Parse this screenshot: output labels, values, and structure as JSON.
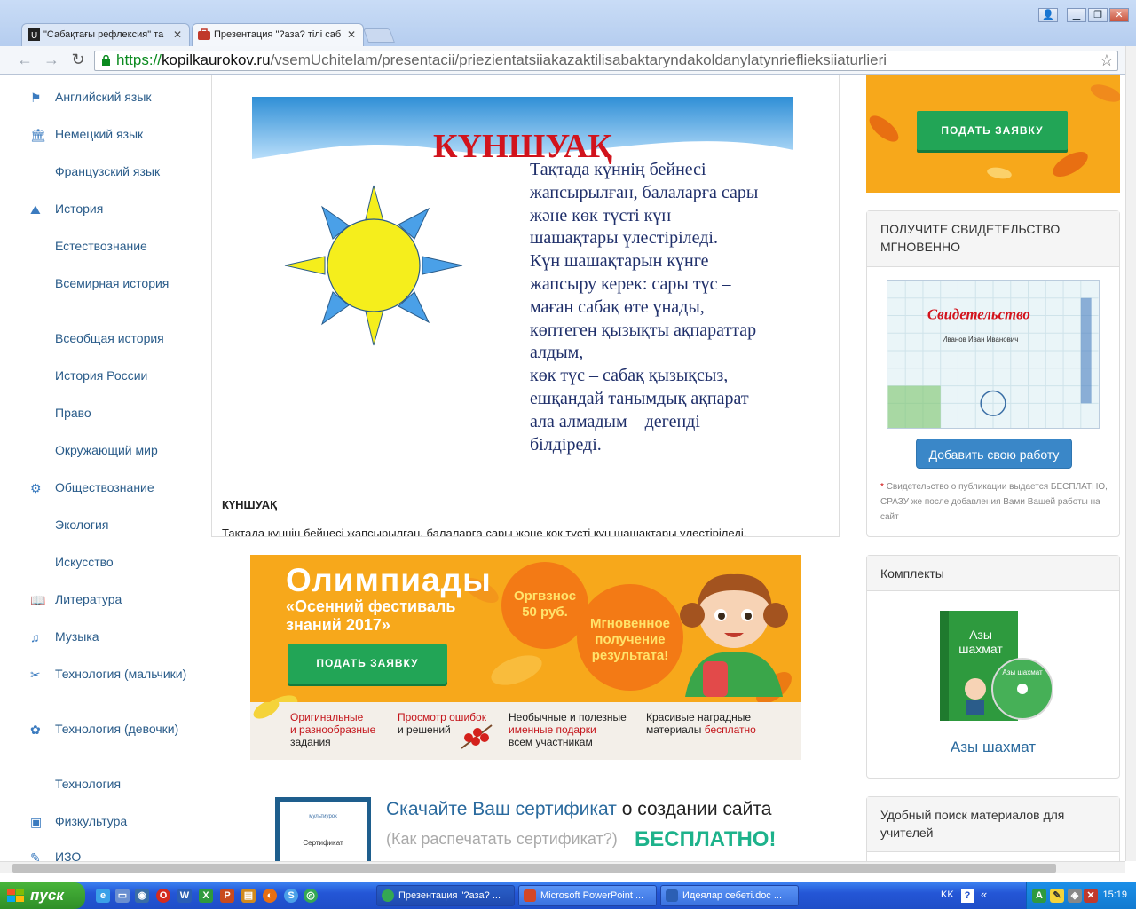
{
  "browser": {
    "tabs": [
      {
        "title": "\"Сабақтағы рефлексия\" та",
        "icon": "ustatv-favicon"
      },
      {
        "title": "Презентация \"?аза? тілі саб",
        "icon": "kopilkaurokov-favicon"
      }
    ],
    "window_buttons": [
      "user-icon",
      "minimize-icon",
      "restore-icon",
      "close-icon"
    ],
    "url": {
      "scheme": "https://",
      "host": "kopilkaurokov.ru",
      "path": "/vsemUchitelam/presentacii/priezientatsiiakazaktilisabaktaryndakoldanylatynrieflieksiiaturlieri"
    }
  },
  "sidebar": {
    "items": [
      {
        "label": "Английский язык",
        "icon": "english-icon"
      },
      {
        "label": "Немецкий язык",
        "icon": "german-icon"
      },
      {
        "label": "Французский язык",
        "icon": ""
      },
      {
        "label": "История",
        "icon": "history-icon"
      },
      {
        "label": "Естествознание",
        "icon": ""
      },
      {
        "label": "Всемирная история",
        "icon": ""
      },
      {
        "label": "Всеобщая история",
        "icon": ""
      },
      {
        "label": "История России",
        "icon": ""
      },
      {
        "label": "Право",
        "icon": ""
      },
      {
        "label": "Окружающий мир",
        "icon": ""
      },
      {
        "label": "Обществознание",
        "icon": "society-icon"
      },
      {
        "label": "Экология",
        "icon": ""
      },
      {
        "label": "Искусство",
        "icon": ""
      },
      {
        "label": "Литература",
        "icon": "book-icon"
      },
      {
        "label": "Музыка",
        "icon": "music-icon"
      },
      {
        "label": "Технология (мальчики)",
        "icon": "tools-icon"
      },
      {
        "label": "Технология (девочки)",
        "icon": "sewing-icon"
      },
      {
        "label": "Технология",
        "icon": ""
      },
      {
        "label": "Физкультура",
        "icon": "sport-icon"
      },
      {
        "label": "ИЗО",
        "icon": "art-icon"
      }
    ]
  },
  "slide": {
    "title": "КҮНШУАҚ",
    "text": "Тақтада күннің бейнесі\nжапсырылған, балаларға сары\nжәне көк түсті күн\nшашақтары  үлестіріледі.\nКүн шашақтарын күнге\nжапсыру керек: сары түс –\nмаған сабақ өте ұнады,\nкөптеген қызықты ақпараттар\nалдым,\n көк түс – сабақ қызықсыз,\nешқандай танымдық ақпарат\nала алмадым – дегенді\nбілдіреді."
  },
  "content": {
    "heading": "КҮНШУАҚ",
    "description": "Тақтада күннің бейнесі жапсырылған, балаларға сары және көк түсті күн шашақтары  үлестіріледі."
  },
  "olympiad_banner": {
    "title": "Олимпиады",
    "subtitle": "«Осенний фестиваль\nзнаний 2017»",
    "button": "ПОДАТЬ ЗАЯВКУ",
    "fee": "Оргвзнос\n50 руб.",
    "instant": "Мгновенное\nполучение\nрезультата!",
    "features": [
      {
        "line1_red": "Оригинальные",
        "line2_red": "и разнообразные",
        "line3": "задания"
      },
      {
        "line1_red": "Просмотр ошибок",
        "line2": "и решений"
      },
      {
        "line1": "Необычные и полезные",
        "line2_red": "именные подарки",
        "line3": "всем участникам"
      },
      {
        "line1": "Красивые наградные",
        "line2": "материалы",
        "line2_red_tail": "бесплатно"
      }
    ]
  },
  "cert_banner": {
    "title_blue": "Скачайте Ваш сертификат",
    "title_dark": "о создании сайта",
    "howto": "(Как распечатать сертификат?)",
    "free": "БЕСПЛАТНО!",
    "thumb_brand": "мультиурок",
    "thumb_label": "Сертификат"
  },
  "right_column": {
    "top_ad_button": "ПОДАТЬ ЗАЯВКУ",
    "certificate_panel": {
      "heading": "ПОЛУЧИТЕ СВИДЕТЕЛЬСТВО МГНОВЕННО",
      "cert_word": "Свидетельство",
      "cert_name": "Иванов Иван Иванович",
      "button": "Добавить свою работу",
      "note_star": "*",
      "note": "Свидетельство о публикации выдается БЕСПЛАТНО, СРАЗУ же после добавления Вами Вашей работы на сайт"
    },
    "kits_panel": {
      "heading": "Комплекты",
      "box_title": "Азы шахмат",
      "disc_label": "Азы шахмат",
      "item": "Азы шахмат"
    },
    "search_panel": {
      "heading": "Удобный поиск материалов для учителей"
    }
  },
  "taskbar": {
    "start": "пуск",
    "tasks": [
      {
        "title": "Презентация \"?аза? ...",
        "icon": "chrome-icon"
      },
      {
        "title": "Microsoft PowerPoint ...",
        "icon": "powerpoint-icon"
      },
      {
        "title": "Идеялар себеті.doc ...",
        "icon": "word-icon"
      }
    ],
    "lang": "KK",
    "clock": "15:19"
  },
  "colors": {
    "accent_orange": "#f7a81b",
    "green_button": "#22a556",
    "blue_button": "#3a87c8",
    "link_blue": "#2a5c8a",
    "slide_title_red": "#d1131c"
  }
}
